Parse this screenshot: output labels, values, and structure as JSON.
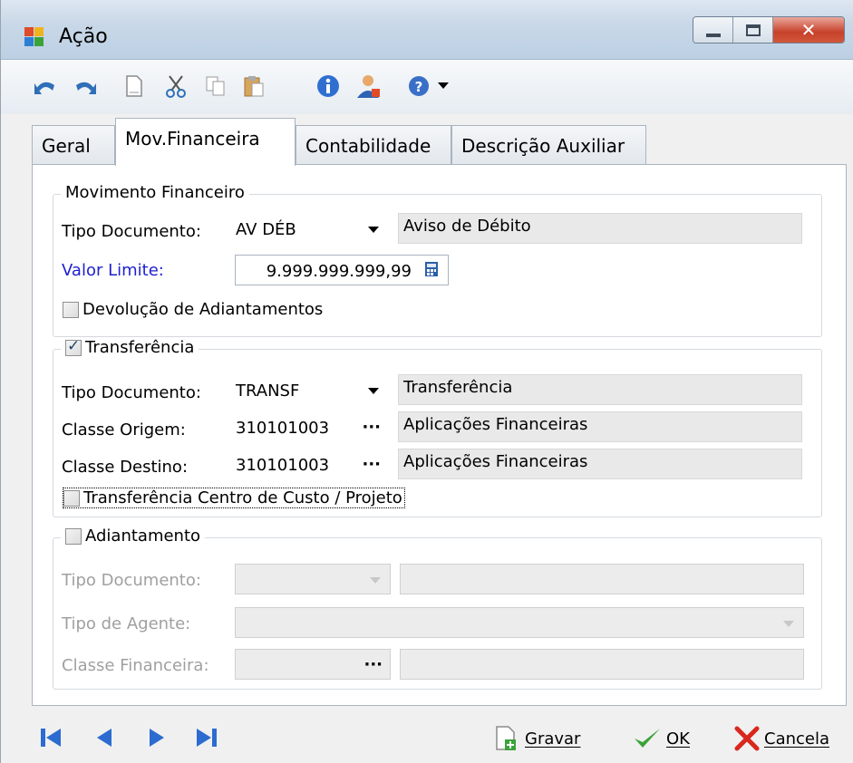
{
  "window": {
    "title": "Ação"
  },
  "toolbar": {
    "icons": [
      "undo-icon",
      "redo-icon",
      "new-document-icon",
      "cut-icon",
      "copy-icon",
      "paste-icon",
      "info-icon",
      "user-icon",
      "help-icon",
      "help-dropdown-icon"
    ]
  },
  "tabs": [
    {
      "label": "Geral",
      "active": false
    },
    {
      "label": "Mov.Financeira",
      "active": true
    },
    {
      "label": "Contabilidade",
      "active": false
    },
    {
      "label": "Descrição Auxiliar",
      "active": false
    }
  ],
  "movimento": {
    "legend": "Movimento Financeiro",
    "tipo_label": "Tipo Documento:",
    "tipo_value": "AV DÉB",
    "tipo_desc": "Aviso de Débito",
    "valor_label": "Valor Limite:",
    "valor_value": "9.999.999.999,99",
    "devolucao_label": "Devolução de Adiantamentos",
    "devolucao_checked": false
  },
  "transferencia": {
    "legend": "Transferência",
    "checked": true,
    "tipo_label": "Tipo Documento:",
    "tipo_value": "TRANSF",
    "tipo_desc": "Transferência",
    "origem_label": "Classe Origem:",
    "origem_value": "310101003",
    "origem_desc": "Aplicações Financeiras",
    "destino_label": "Classe Destino:",
    "destino_value": "310101003",
    "destino_desc": "Aplicações Financeiras",
    "centro_label": "Transferência Centro de Custo / Projeto",
    "centro_checked": false
  },
  "adiantamento": {
    "legend": "Adiantamento",
    "checked": false,
    "tipo_label": "Tipo Documento:",
    "agente_label": "Tipo de Agente:",
    "classe_label": "Classe Financeira:"
  },
  "footer": {
    "gravar": "Gravar",
    "ok": "OK",
    "cancela": "Cancela"
  },
  "colors": {
    "valor_label": "#1f1fd0",
    "ok_check": "#3aa33a",
    "cancel_x": "#d8281e",
    "nav_blue": "#2c6bd0"
  }
}
